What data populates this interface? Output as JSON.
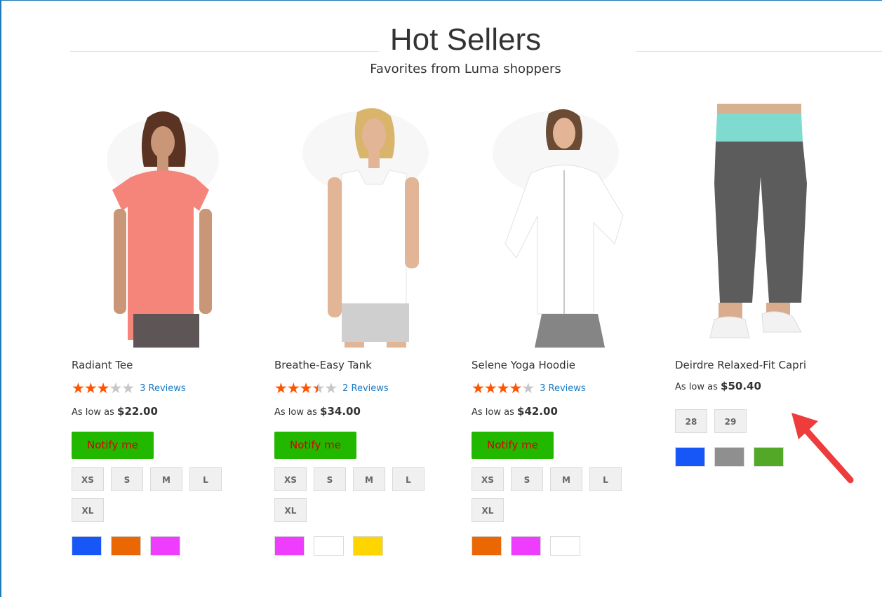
{
  "section": {
    "title": "Hot Sellers",
    "subtitle": "Favorites from Luma shoppers"
  },
  "products": [
    {
      "name": "Radiant Tee",
      "rating_stars": 3,
      "reviews": "3  Reviews",
      "price_prefix": "As low as",
      "price": "$22.00",
      "notify": "Notify me",
      "sizes": [
        "XS",
        "S",
        "M",
        "L",
        "XL"
      ],
      "colors": [
        "#1857f7",
        "#eb6703",
        "#ef3dff"
      ]
    },
    {
      "name": "Breathe-Easy Tank",
      "rating_stars": 3.5,
      "reviews": "2  Reviews",
      "price_prefix": "As low as",
      "price": "$34.00",
      "notify": "Notify me",
      "sizes": [
        "XS",
        "S",
        "M",
        "L",
        "XL"
      ],
      "colors": [
        "#ef3dff",
        "#ffffff",
        "#ffd500"
      ]
    },
    {
      "name": "Selene Yoga Hoodie",
      "rating_stars": 4,
      "reviews": "3  Reviews",
      "price_prefix": "As low as",
      "price": "$42.00",
      "notify": "Notify me",
      "sizes": [
        "XS",
        "S",
        "M",
        "L",
        "XL"
      ],
      "colors": [
        "#eb6703",
        "#ef3dff",
        "#ffffff"
      ]
    },
    {
      "name": "Deirdre Relaxed-Fit Capri",
      "price_prefix": "As low as",
      "price": "$50.40",
      "sizes": [
        "28",
        "29"
      ],
      "colors": [
        "#1857f7",
        "#8f8f8f",
        "#53a828"
      ]
    }
  ],
  "colors": {
    "rating_star": "#ff5501",
    "notify_bg": "#22b800",
    "notify_text": "#d60000",
    "link": "#1979c3",
    "annotation_arrow": "#ee3b3b"
  }
}
